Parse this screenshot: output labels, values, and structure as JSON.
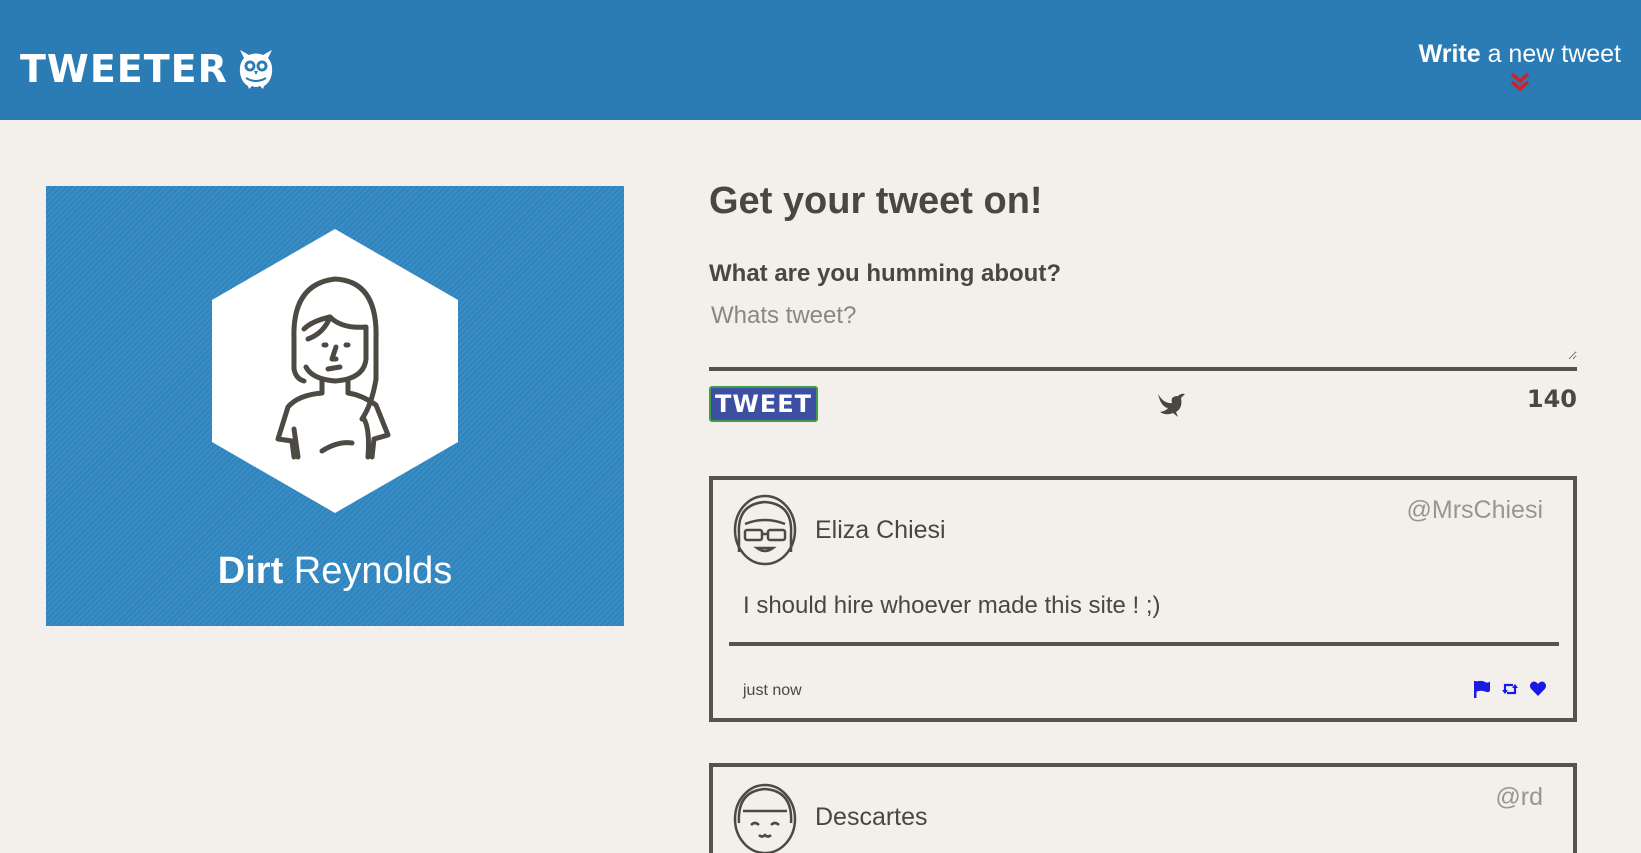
{
  "header": {
    "logo_text": "TWEETER",
    "logo_icon": "owl-icon",
    "write_bold": "Write",
    "write_rest": " a new tweet",
    "chevron_icon": "double-chevron-down-icon"
  },
  "profile": {
    "first_name": "Dirt",
    "last_name": " Reynolds",
    "background_color": "#3288c2",
    "avatar_icon": "woman-avatar-icon"
  },
  "compose": {
    "title": "Get your tweet on!",
    "label": "What are you humming about?",
    "placeholder": "Whats tweet?",
    "button_label": "TWEET",
    "bird_icon": "bird-icon",
    "char_count": "140"
  },
  "tweets": [
    {
      "name": "Eliza Chiesi",
      "handle": "@MrsChiesi",
      "body": "I should hire whoever made this site ! ;)",
      "time": "just now",
      "actions": [
        "flag-icon",
        "retweet-icon",
        "heart-icon"
      ]
    },
    {
      "name": "Descartes",
      "handle": "@rd"
    }
  ],
  "colors": {
    "header_bg": "#2b7bb5",
    "page_bg": "#f3f0ec",
    "text": "#4a4740",
    "button_bg": "#3d4fa2",
    "action_blue": "#1a1ae6",
    "chevron_red": "#d0202a"
  }
}
